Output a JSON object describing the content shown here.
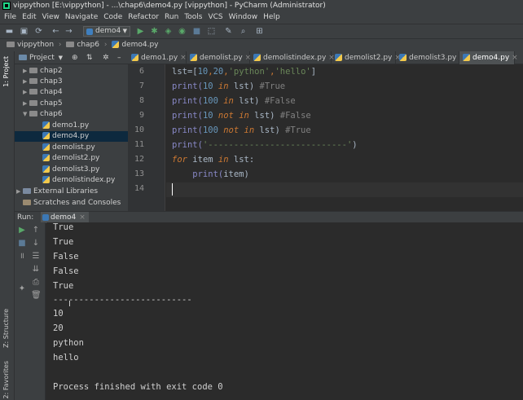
{
  "window": {
    "title": "vippython [E:\\vippython] - ...\\chap6\\demo4.py [vippython] - PyCharm (Administrator)"
  },
  "menu": [
    "File",
    "Edit",
    "View",
    "Navigate",
    "Code",
    "Refactor",
    "Run",
    "Tools",
    "VCS",
    "Window",
    "Help"
  ],
  "toolbar": {
    "run_config": "demo4"
  },
  "breadcrumb": [
    "vippython",
    "chap6",
    "demo4.py"
  ],
  "left_strip": {
    "project": "1: Project",
    "structure": "Z: Structure",
    "favorites": "2: Favorites"
  },
  "project_panel": {
    "header": "Project",
    "items": [
      {
        "label": "chap2",
        "kind": "folder"
      },
      {
        "label": "chap3",
        "kind": "folder"
      },
      {
        "label": "chap4",
        "kind": "folder"
      },
      {
        "label": "chap5",
        "kind": "folder"
      },
      {
        "label": "chap6",
        "kind": "folder-open"
      },
      {
        "label": "demo1.py",
        "kind": "file"
      },
      {
        "label": "demo4.py",
        "kind": "file",
        "selected": true
      },
      {
        "label": "demolist.py",
        "kind": "file"
      },
      {
        "label": "demolist2.py",
        "kind": "file"
      },
      {
        "label": "demolist3.py",
        "kind": "file"
      },
      {
        "label": "demolistindex.py",
        "kind": "file"
      },
      {
        "label": "External Libraries",
        "kind": "lib"
      },
      {
        "label": "Scratches and Consoles",
        "kind": "scratch"
      }
    ]
  },
  "tabs": [
    {
      "label": "demo1.py"
    },
    {
      "label": "demolist.py"
    },
    {
      "label": "demolistindex.py"
    },
    {
      "label": "demolist2.py"
    },
    {
      "label": "demolist3.py"
    },
    {
      "label": "demo4.py",
      "active": true
    }
  ],
  "editor": {
    "line_numbers": [
      "6",
      "7",
      "8",
      "9",
      "10",
      "11",
      "12",
      "13",
      "14"
    ],
    "code": {
      "l6": {
        "a": "lst=[",
        "b": "10",
        "c": ",",
        "d": "20",
        "e": ",",
        "f": "'python'",
        "g": ",",
        "h": "'hello'",
        "i": "]"
      },
      "l7": {
        "a": "print(",
        "b": "10",
        "c": " in ",
        "d": "lst) ",
        "e": "#True"
      },
      "l8": {
        "a": "print(",
        "b": "100",
        "c": " in ",
        "d": "lst) ",
        "e": "#False"
      },
      "l9": {
        "a": "print(",
        "b": "10",
        "c": " not in ",
        "d": "lst) ",
        "e": "#False"
      },
      "l10": {
        "a": "print(",
        "b": "100",
        "c": " not in ",
        "d": "lst) ",
        "e": "#True"
      },
      "l11": {
        "a": "print(",
        "b": "'---------------------------'",
        "c": ")"
      },
      "l12": {
        "a": "for ",
        "b": "item ",
        "c": "in ",
        "d": "lst:"
      },
      "l13": {
        "a": "    print(",
        "b": "item)"
      }
    }
  },
  "run_panel": {
    "label": "Run:",
    "tab": "demo4",
    "output": [
      "True",
      "True",
      "False",
      "False",
      "True",
      "---------------------------",
      "10",
      "20",
      "python",
      "hello",
      "",
      "Process finished with exit code 0"
    ]
  }
}
